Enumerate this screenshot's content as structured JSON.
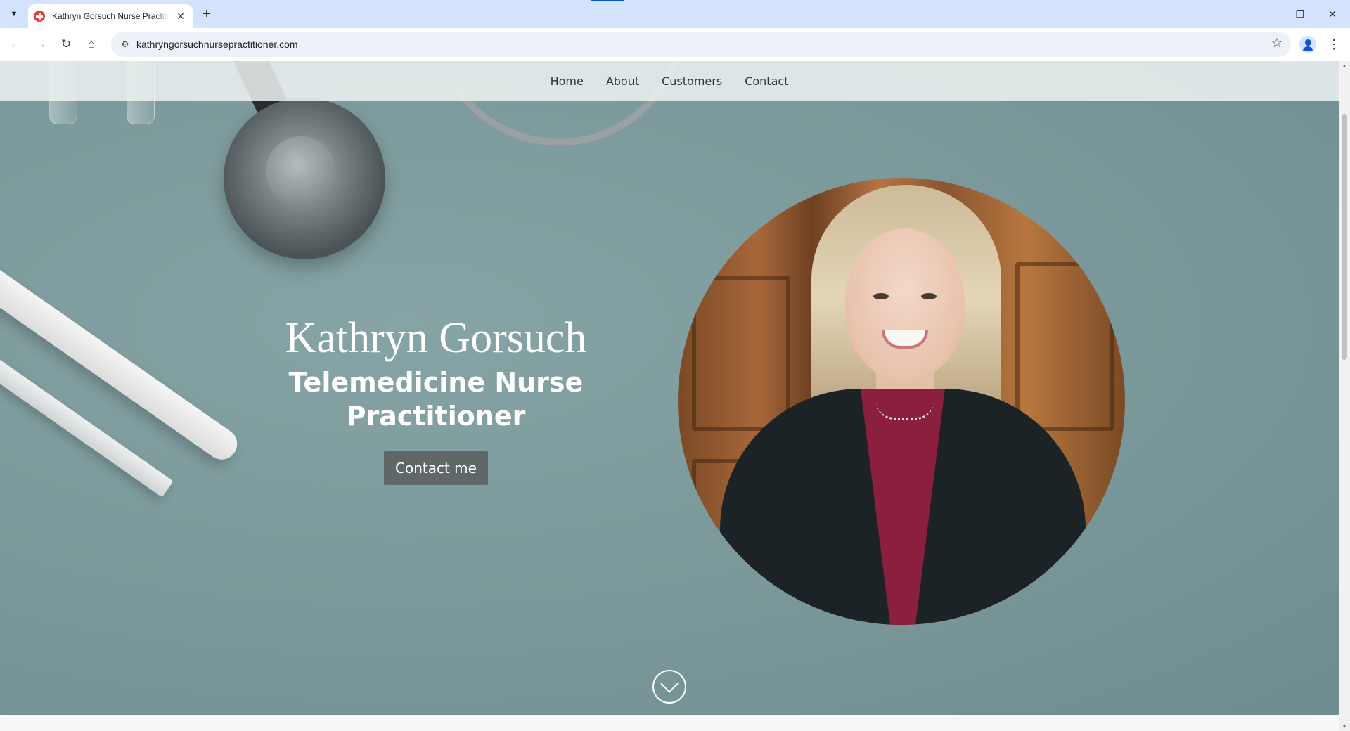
{
  "browser": {
    "tab_title": "Kathryn Gorsuch Nurse Practitioner",
    "url": "kathryngorsuchnursepractitioner.com",
    "icons": [
      "tab-search-icon",
      "favicon-icon",
      "close-icon",
      "new-tab-icon",
      "minimize-icon",
      "restore-icon",
      "close-window-icon",
      "back-icon",
      "forward-icon",
      "reload-icon",
      "home-icon",
      "site-info-icon",
      "bookmark-star-icon",
      "profile-icon",
      "menu-icon"
    ],
    "accent_color": "#0b57d0"
  },
  "site": {
    "nav": [
      {
        "label": "Home"
      },
      {
        "label": "About"
      },
      {
        "label": "Customers"
      },
      {
        "label": "Contact"
      }
    ],
    "hero": {
      "name": "Kathryn Gorsuch",
      "role": "Telemedicine Nurse Practitioner",
      "cta_label": "Contact me",
      "background_color": "#7a9899",
      "button_color": "#5f6769"
    }
  }
}
